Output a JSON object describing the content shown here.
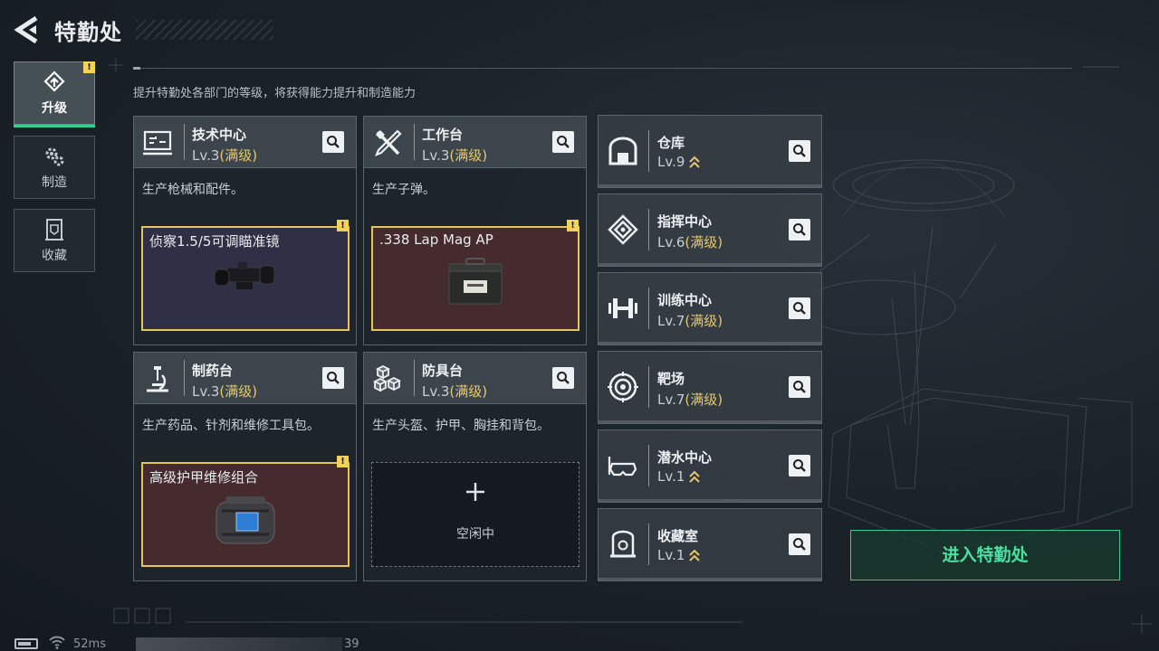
{
  "header": {
    "title": "特勤处"
  },
  "subtitle": "提升特勤处各部门的等级，将获得能力提升和制造能力",
  "tabs": [
    {
      "label": "升级",
      "icon": "upgrade-icon",
      "active": true,
      "alert": true
    },
    {
      "label": "制造",
      "icon": "gears-icon",
      "active": false,
      "alert": false
    },
    {
      "label": "收藏",
      "icon": "collection-icon",
      "active": false,
      "alert": false
    }
  ],
  "workshops": [
    {
      "name": "技术中心",
      "level": "Lv.3",
      "status": "(满级)",
      "icon": "computer-icon",
      "desc": "生产枪械和配件。",
      "product": "侦察1.5/5可调瞄准镜",
      "product_icon": "scope-icon",
      "alert": true
    },
    {
      "name": "工作台",
      "level": "Lv.3",
      "status": "(满级)",
      "icon": "tools-icon",
      "desc": "生产子弹。",
      "product": ".338 Lap Mag AP",
      "product_icon": "ammo-box-icon",
      "alert": true
    },
    {
      "name": "制药台",
      "level": "Lv.3",
      "status": "(满级)",
      "icon": "microscope-icon",
      "desc": "生产药品、针剂和维修工具包。",
      "product": "高级护甲维修组合",
      "product_icon": "repair-kit-icon",
      "alert": true
    },
    {
      "name": "防具台",
      "level": "Lv.3",
      "status": "(满级)",
      "icon": "armor-blocks-icon",
      "desc": "生产头盔、护甲、胸挂和背包。",
      "idle_label": "空闲中"
    }
  ],
  "facilities": [
    {
      "name": "仓库",
      "level": "Lv.9",
      "status": "",
      "upgradable": true,
      "icon": "warehouse-icon"
    },
    {
      "name": "指挥中心",
      "level": "Lv.6",
      "status": "(满级)",
      "upgradable": false,
      "icon": "chip-icon"
    },
    {
      "name": "训练中心",
      "level": "Lv.7",
      "status": "(满级)",
      "upgradable": false,
      "icon": "dumbbell-icon"
    },
    {
      "name": "靶场",
      "level": "Lv.7",
      "status": "(满级)",
      "upgradable": false,
      "icon": "target-icon"
    },
    {
      "name": "潜水中心",
      "level": "Lv.1",
      "status": "",
      "upgradable": true,
      "icon": "diving-mask-icon"
    },
    {
      "name": "收藏室",
      "level": "Lv.1",
      "status": "",
      "upgradable": true,
      "icon": "vault-icon"
    }
  ],
  "enter_button": "进入特勤处",
  "status_bar": {
    "ping": "52ms",
    "value": "39"
  },
  "alert_symbol": "!",
  "colors": {
    "accent": "#2fd08c",
    "maxed": "#e7c86a",
    "alert": "#f2d35a",
    "product_border": "#e7c35c"
  }
}
